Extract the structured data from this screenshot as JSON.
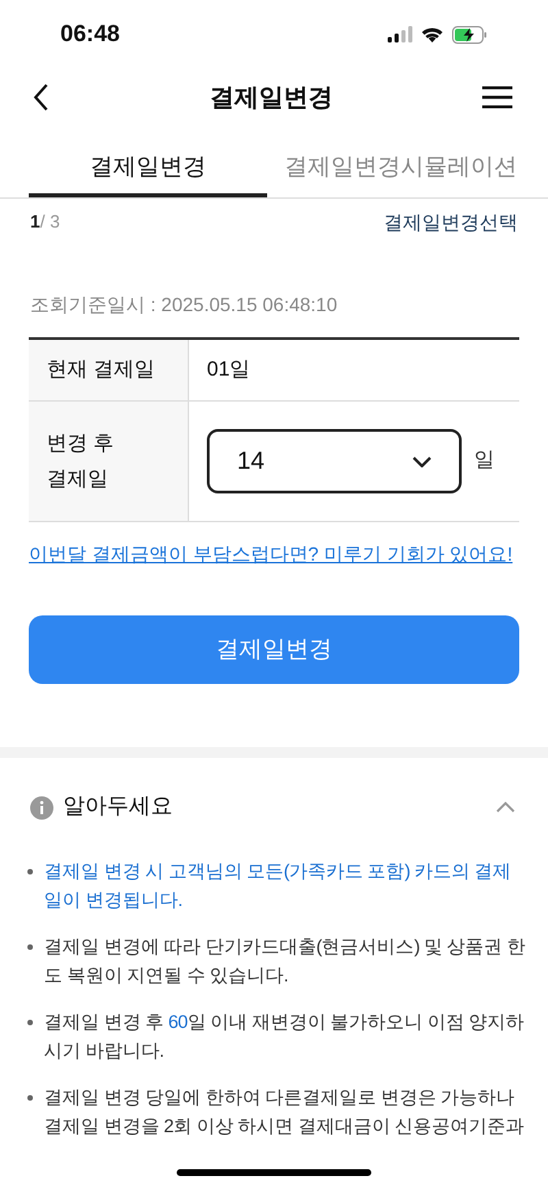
{
  "status_bar": {
    "time": "06:48"
  },
  "header": {
    "title": "결제일변경"
  },
  "tabs": [
    {
      "label": "결제일변경",
      "selected": true
    },
    {
      "label": "결제일변경시뮬레이션",
      "selected": false
    }
  ],
  "step": {
    "current": "1",
    "total": "/ 3",
    "link": "결제일변경선택"
  },
  "query_time": "조회기준일시 : 2025.05.15 06:48:10",
  "table": {
    "rows": [
      {
        "kind": "text",
        "label": "현재 결제일",
        "value": "01일"
      },
      {
        "kind": "select",
        "label": "변경 후\n결제일",
        "value": "14",
        "suffix": "일"
      }
    ]
  },
  "defer_link": "이번달 결제금액이 부담스럽다면? 미루기 기회가 있어요!",
  "submit_button": "결제일변경",
  "notice": {
    "title": "알아두세요",
    "expanded": true,
    "items": [
      [
        {
          "text": "결제일 변경 시 고객님의 모든(가족카드 포함) 카드의 결제일이 변경됩니다.",
          "highlight": true
        }
      ],
      [
        {
          "text": "결제일 변경에 따라 단기카드대출(현금서비스) 및 상품권 한도 복원이 지연될 수 있습니다.",
          "highlight": false
        }
      ],
      [
        {
          "text": "결제일 변경 후 ",
          "highlight": false
        },
        {
          "text": "60",
          "highlight": true
        },
        {
          "text": "일 이내 재변경이 불가하오니 이점 양지하시기 바랍니다.",
          "highlight": false
        }
      ],
      [
        {
          "text": "결제일 변경 당일에 한하여 다른결제일로 변경은 가능하나 결제일 변경을 2회 이상 하시면 결제대금이 신용공여기준과",
          "highlight": false
        }
      ]
    ]
  }
}
